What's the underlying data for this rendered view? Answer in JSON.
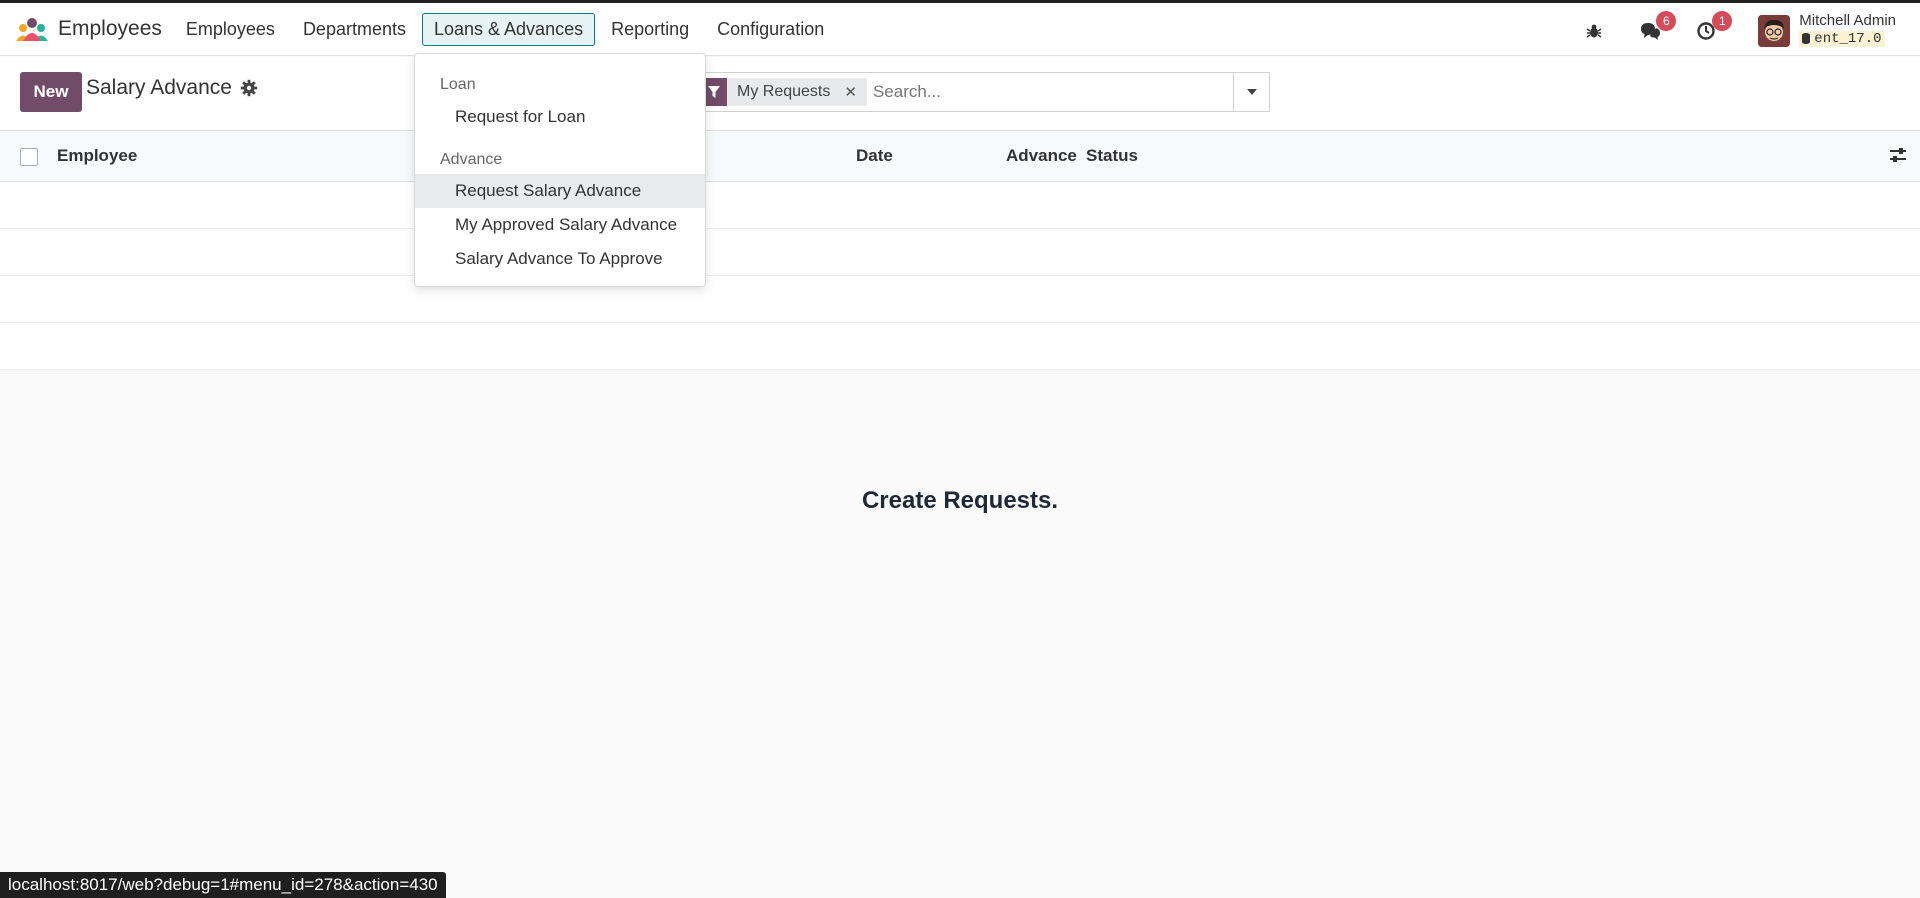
{
  "app": {
    "name": "Employees",
    "brand_colors": {
      "accent": "#714b67",
      "teal": "#017e84"
    }
  },
  "nav": {
    "items": [
      {
        "label": "Employees"
      },
      {
        "label": "Departments"
      },
      {
        "label": "Loans & Advances"
      },
      {
        "label": "Reporting"
      },
      {
        "label": "Configuration"
      }
    ],
    "active_index": 2
  },
  "systray": {
    "debug_icon": "bug-icon",
    "messages_count": "6",
    "activities_count": "1",
    "user_name": "Mitchell Admin",
    "database": "ent_17.0"
  },
  "control_panel": {
    "new_button": "New",
    "title": "Salary Advance",
    "settings_icon": "gear-icon",
    "search": {
      "facet_label": "My Requests",
      "facet_icon": "filter-icon",
      "placeholder": "Search..."
    }
  },
  "list": {
    "columns": [
      "Employee",
      "Date",
      "Advance",
      "Status"
    ],
    "empty_message": "Create Requests."
  },
  "dropdown": {
    "sections": [
      {
        "header": "Loan",
        "items": [
          {
            "label": "Request for Loan"
          }
        ]
      },
      {
        "header": "Advance",
        "items": [
          {
            "label": "Request Salary Advance",
            "highlighted": true
          },
          {
            "label": "My Approved Salary Advance"
          },
          {
            "label": "Salary Advance To Approve"
          }
        ]
      }
    ]
  },
  "status_bar": {
    "url": "localhost:8017/web?debug=1#menu_id=278&action=430"
  }
}
